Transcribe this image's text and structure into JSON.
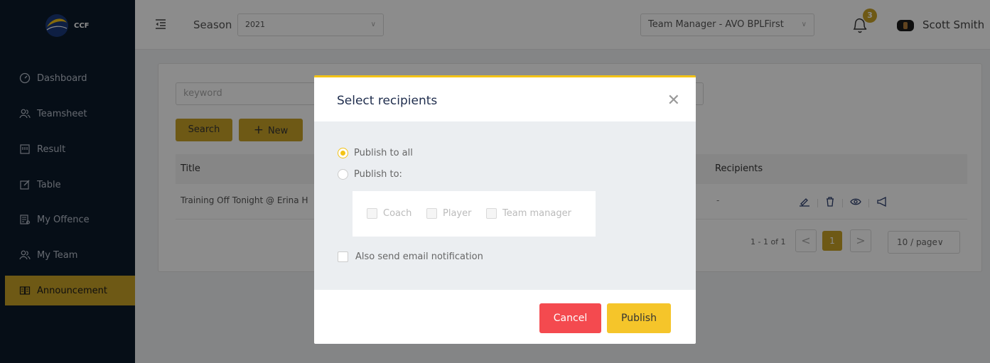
{
  "app": {
    "logo_text": "CCF"
  },
  "sidebar": {
    "items": [
      {
        "label": "Dashboard",
        "icon": "dashboard-icon"
      },
      {
        "label": "Teamsheet",
        "icon": "users-icon"
      },
      {
        "label": "Result",
        "icon": "scoreboard-icon"
      },
      {
        "label": "Table",
        "icon": "edit-icon"
      },
      {
        "label": "My Offence",
        "icon": "report-icon"
      },
      {
        "label": "My Team",
        "icon": "users-icon"
      },
      {
        "label": "Announcement",
        "icon": "book-icon",
        "active": true
      }
    ]
  },
  "header": {
    "season_label": "Season",
    "season_value": "2021",
    "team_value": "Team Manager - AVO BPLFirst",
    "notification_count": "3",
    "username": "Scott Smith"
  },
  "toolbar": {
    "keyword_placeholder": "keyword",
    "search_label": "Search",
    "new_label": "New"
  },
  "table": {
    "columns": [
      "Title",
      "Recipients"
    ],
    "rows": [
      {
        "title": "Training Off Tonight @ Erina H",
        "recipients": "-"
      }
    ]
  },
  "pagination": {
    "range_text": "1 - 1 of 1",
    "current_page": "1",
    "page_size": "10 / page"
  },
  "modal": {
    "title": "Select recipients",
    "option_all": "Publish to all",
    "option_to": "Publish to:",
    "selected_option": "all",
    "roles": [
      "Coach",
      "Player",
      "Team manager"
    ],
    "email_label": "Also send email notification",
    "cancel_label": "Cancel",
    "publish_label": "Publish"
  },
  "colors": {
    "accent": "#c9a227",
    "sidebar_bg": "#0c1a2b",
    "danger": "#f44a4f",
    "primary_yellow": "#f5c52a"
  }
}
